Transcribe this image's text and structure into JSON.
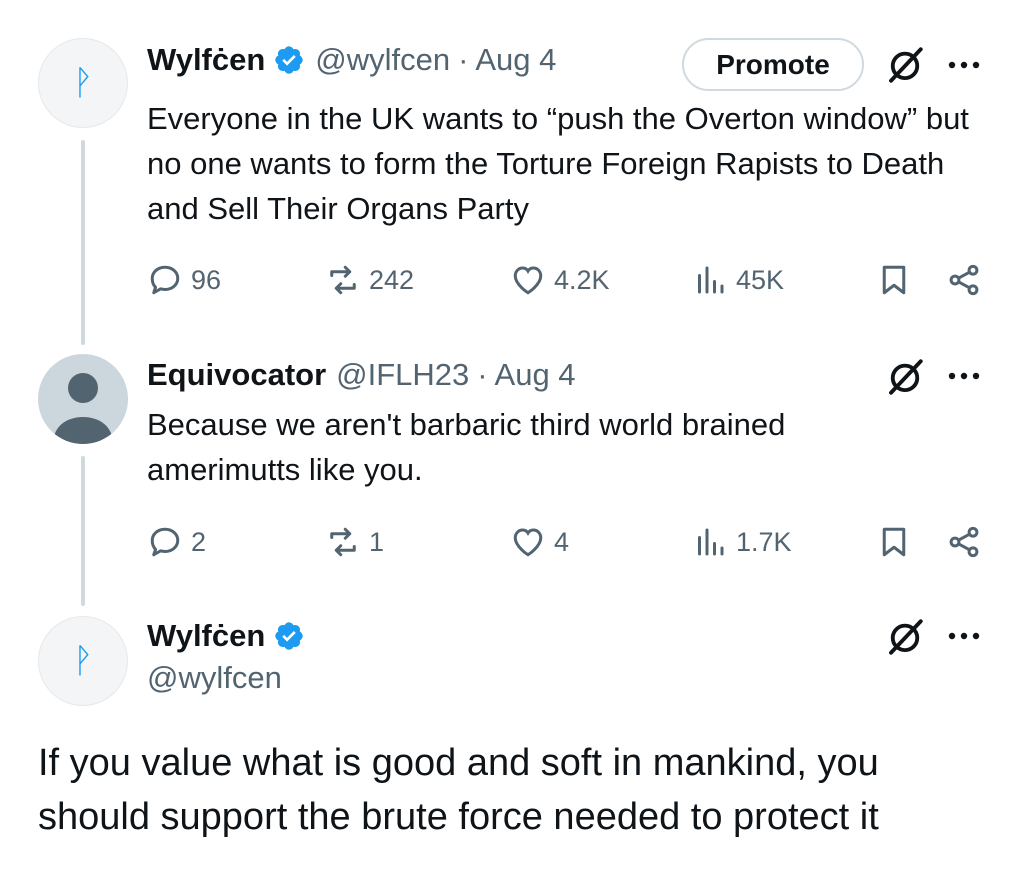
{
  "tweets": [
    {
      "name": "Wylfċen",
      "handle": "@wylfcen",
      "date": "· Aug 4",
      "text": "Everyone in the UK wants to “push the Overton window” but no one wants to form the Torture Foreign Rapists to Death and Sell Their Organs Party",
      "promote_label": "Promote",
      "stats": {
        "replies": "96",
        "reposts": "242",
        "likes": "4.2K",
        "views": "45K"
      }
    },
    {
      "name": "Equivocator",
      "handle": "@IFLH23",
      "date": "· Aug 4",
      "text": "Because we aren't barbaric third world brained amerimutts like you.",
      "stats": {
        "replies": "2",
        "reposts": "1",
        "likes": "4",
        "views": "1.7K"
      }
    }
  ],
  "main": {
    "name": "Wylfċen",
    "handle": "@wylfcen",
    "text": "If you value what is good and soft in mankind, you should support the brute force needed to protect it"
  },
  "avatar_glyph": "ᚹ",
  "colors": {
    "accent": "#1d9bf0",
    "muted": "#536471",
    "text": "#0f1419",
    "line": "#cfd9de"
  }
}
